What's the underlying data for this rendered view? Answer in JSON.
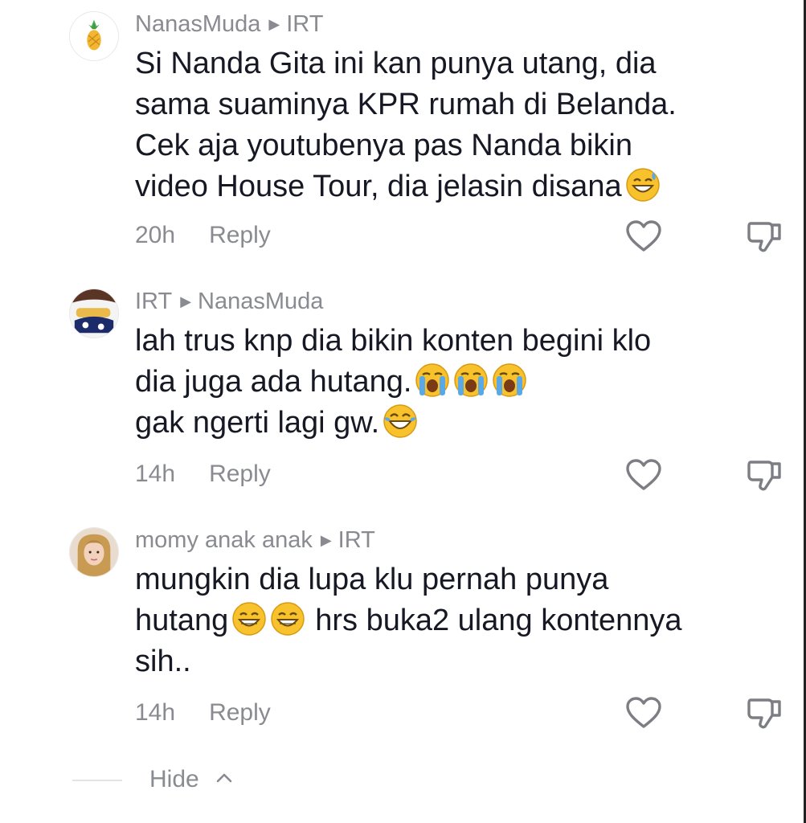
{
  "comments": [
    {
      "author": "NanasMuda",
      "reply_to": "IRT",
      "lines": [
        "Si Nanda Gita ini kan punya utang, dia",
        "sama suaminya KPR rumah di Belanda.",
        "Cek aja youtubenya pas Nanda bikin",
        "video House Tour, dia jelasin disana"
      ],
      "time": "20h",
      "reply_label": "Reply"
    },
    {
      "author": "IRT",
      "reply_to": "NanasMuda",
      "lines": [
        "lah trus knp dia bikin konten begini klo",
        "dia juga ada hutang.",
        "gak ngerti lagi gw."
      ],
      "time": "14h",
      "reply_label": "Reply"
    },
    {
      "author": "momy anak anak",
      "reply_to": "IRT",
      "lines": [
        "mungkin dia lupa klu pernah punya",
        "hutang",
        "hrs buka2 ulang kontennya",
        "sih.."
      ],
      "time": "14h",
      "reply_label": "Reply"
    }
  ],
  "hide_label": "Hide",
  "icons": {
    "like": "heart-outline-icon",
    "dislike": "thumbs-down-outline-icon",
    "reply_arrow": "right-triangle-icon",
    "hide": "chevron-up-icon"
  },
  "colors": {
    "text": "#161823",
    "muted": "#8a8b91",
    "emoji_yellow": "#f8c22d",
    "tear_blue": "#5aa9e6"
  }
}
